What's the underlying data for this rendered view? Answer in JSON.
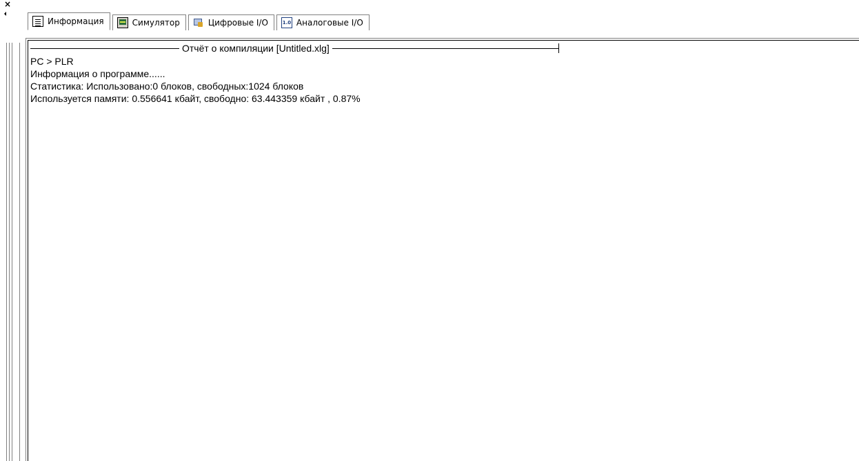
{
  "panel_controls": {
    "close_glyph": "×"
  },
  "tabs": [
    {
      "label": "Информация",
      "icon": "info-document-icon",
      "active": true
    },
    {
      "label": "Симулятор",
      "icon": "simulator-icon",
      "active": false
    },
    {
      "label": "Цифровые I/O",
      "icon": "digital-io-icon",
      "active": false
    },
    {
      "label": "Аналоговые I/O",
      "icon": "analog-io-icon",
      "active": false,
      "icon_text": "1.0"
    }
  ],
  "report": {
    "title": "Отчёт о компиляции [Untitled.xlg]",
    "lines": [
      "PC > PLR",
      "Информация о программе......",
      "Статистика: Использовано:0 блоков, свободных:1024 блоков",
      "Используется памяти: 0.556641 кбайт, свободно: 63.443359 кбайт , 0.87%"
    ]
  }
}
